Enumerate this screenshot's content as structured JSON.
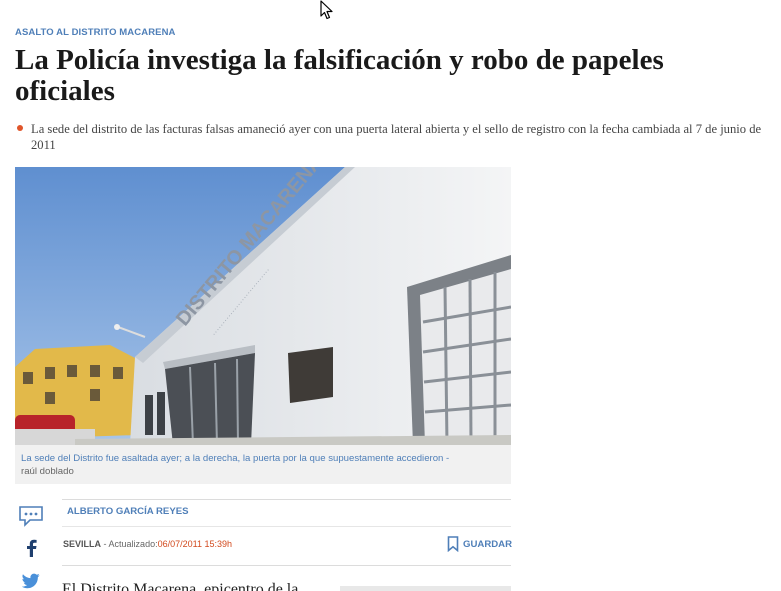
{
  "article": {
    "kicker": "ASALTO AL DISTRITO MACARENA",
    "headline": "La Policía investiga la falsificación y robo de papeles oficiales",
    "summary": "La sede del distrito de las facturas falsas amaneció ayer con una puerta lateral abierta y el sello de registro con la fecha cambiada al 7 de junio de 2011",
    "photo": {
      "sign": "DISTRITO MACARENA"
    },
    "caption": {
      "text": "La sede del Distrito fue asaltada ayer; a la derecha, la puerta por la que supuestamente accedieron -",
      "credit": "raúl doblado"
    },
    "byline": {
      "author": "ALBERTO GARCÍA REYES",
      "city": "SEVILLA",
      "separator": "-",
      "updated_label": "Actualizado:",
      "updated_date": "06/07/2011 15:39h",
      "save_label": "GUARDAR"
    },
    "body_start": "El Distrito Macarena, epicentro de la"
  },
  "share": {
    "icons": [
      "comments-icon",
      "facebook-icon",
      "twitter-icon"
    ]
  },
  "colors": {
    "accent": "#4f7fb8",
    "date": "#d24a1e",
    "bullet": "#e0552a"
  }
}
